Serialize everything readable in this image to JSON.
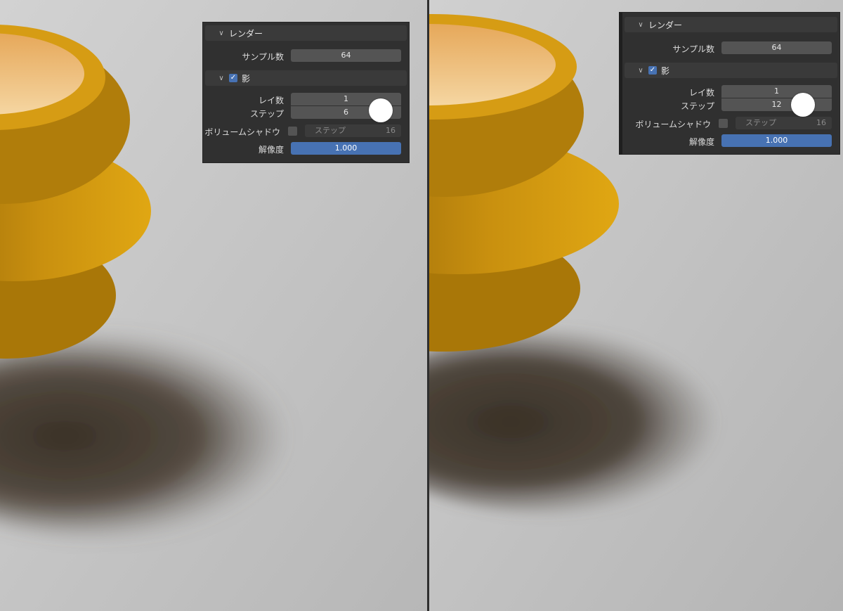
{
  "panels": [
    {
      "render_section": {
        "title": "レンダー",
        "icon": "chevron-down-icon"
      },
      "samples": {
        "label": "サンプル数",
        "value": "64"
      },
      "shadow_section": {
        "title": "影",
        "checked": true,
        "icon": "chevron-down-icon"
      },
      "rays": {
        "label": "レイ数",
        "value": "1"
      },
      "steps": {
        "label": "ステップ",
        "value": "6"
      },
      "volume_shadow": {
        "label": "ボリュームシャドウ",
        "checked": false,
        "step_label": "ステップ",
        "step_value": "16"
      },
      "resolution": {
        "label": "解像度",
        "value": "1.000"
      }
    },
    {
      "render_section": {
        "title": "レンダー",
        "icon": "chevron-down-icon"
      },
      "samples": {
        "label": "サンプル数",
        "value": "64"
      },
      "shadow_section": {
        "title": "影",
        "checked": true,
        "icon": "chevron-down-icon"
      },
      "rays": {
        "label": "レイ数",
        "value": "1"
      },
      "steps": {
        "label": "ステップ",
        "value": "12"
      },
      "volume_shadow": {
        "label": "ボリュームシャドウ",
        "checked": false,
        "step_label": "ステップ",
        "step_value": "16"
      },
      "resolution": {
        "label": "解像度",
        "value": "1.000"
      }
    }
  ],
  "colors": {
    "accent": "#4772b3",
    "pot": "#c9900f",
    "floor": "#bdbdbd",
    "panel": "#303030"
  }
}
